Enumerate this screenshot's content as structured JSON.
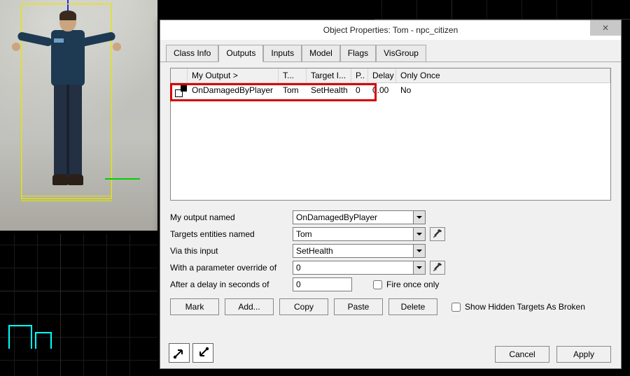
{
  "dialog": {
    "title": "Object Properties: Tom - npc_citizen",
    "tabs": [
      "Class Info",
      "Outputs",
      "Inputs",
      "Model",
      "Flags",
      "VisGroup"
    ],
    "active_tab": 1
  },
  "table": {
    "headers": {
      "output": "My Output  >",
      "target": "T...",
      "input": "Target I...",
      "param": "P..",
      "delay": "Delay",
      "once": "Only Once"
    },
    "rows": [
      {
        "icon": "io-icon",
        "output": "OnDamagedByPlayer",
        "target": "Tom",
        "input": "SetHealth",
        "param": "0",
        "delay": "0.00",
        "once": "No"
      }
    ]
  },
  "form": {
    "labels": {
      "output": "My output named",
      "target": "Targets entities named",
      "input": "Via this input",
      "param": "With a parameter override of",
      "delay": "After a delay in seconds of",
      "fire_once": "Fire once only"
    },
    "values": {
      "output": "OnDamagedByPlayer",
      "target": "Tom",
      "input": "SetHealth",
      "param": "0",
      "delay": "0"
    },
    "fire_once": false
  },
  "actions": {
    "mark": "Mark",
    "add": "Add...",
    "copy": "Copy",
    "paste": "Paste",
    "delete": "Delete",
    "show_hidden": "Show Hidden Targets As Broken"
  },
  "footer": {
    "cancel": "Cancel",
    "apply": "Apply"
  }
}
